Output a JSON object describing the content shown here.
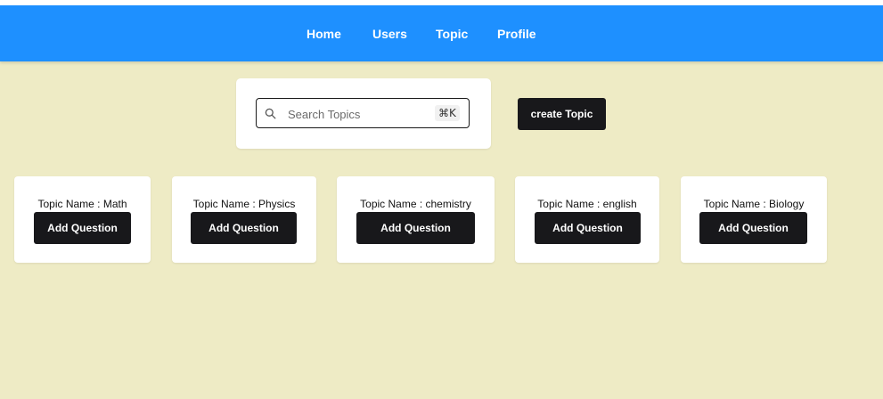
{
  "nav": {
    "links": [
      "Home",
      "Users",
      "Topic",
      "Profile"
    ],
    "background": "#1e90ff"
  },
  "search": {
    "placeholder": "Search Topics",
    "shortcut": "⌘K",
    "icon": "search-icon"
  },
  "create_topic_label": "create Topic",
  "topics": [
    {
      "name_label": "Topic Name : Math",
      "button_label": "Add Question"
    },
    {
      "name_label": "Topic Name : Physics",
      "button_label": "Add Question"
    },
    {
      "name_label": "Topic Name : chemistry",
      "button_label": "Add Question"
    },
    {
      "name_label": "Topic Name : english",
      "button_label": "Add Question"
    },
    {
      "name_label": "Topic Name : Biology",
      "button_label": "Add Question"
    }
  ],
  "colors": {
    "page_background": "#eeebc5",
    "button_dark": "#18181b"
  }
}
